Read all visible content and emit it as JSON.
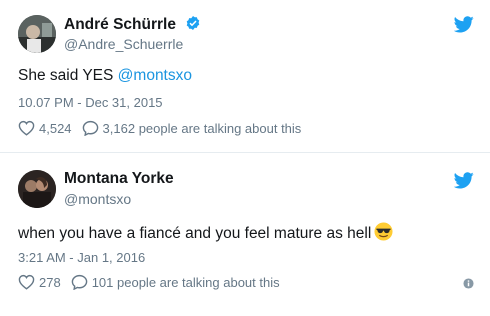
{
  "tweets": [
    {
      "author_name": "André Schürrle",
      "author_handle": "@Andre_Schuerrle",
      "verified": true,
      "text_plain": "She said YES ",
      "mention": "@montsxo",
      "timestamp": "10.07 PM - Dec 31, 2015",
      "likes": "4,524",
      "talking": "3,162 people are talking about this"
    },
    {
      "author_name": "Montana Yorke",
      "author_handle": "@montsxo",
      "verified": false,
      "text_plain": "when you have a fiancé and you feel mature as hell",
      "emoji": "sunglasses-emoji",
      "timestamp": "3:21 AM - Jan 1, 2016",
      "likes": "278",
      "talking": "101 people are talking about this"
    }
  ],
  "colors": {
    "brand_blue": "#1da1f2",
    "link_blue": "#1b95e0",
    "muted": "#657786",
    "text": "#14171a",
    "divider": "#e6ecf0"
  },
  "icons": {
    "bird": "twitter-bird-icon",
    "verified": "verified-badge-icon",
    "like": "heart-icon",
    "reply": "speech-bubble-icon",
    "info": "info-icon"
  }
}
